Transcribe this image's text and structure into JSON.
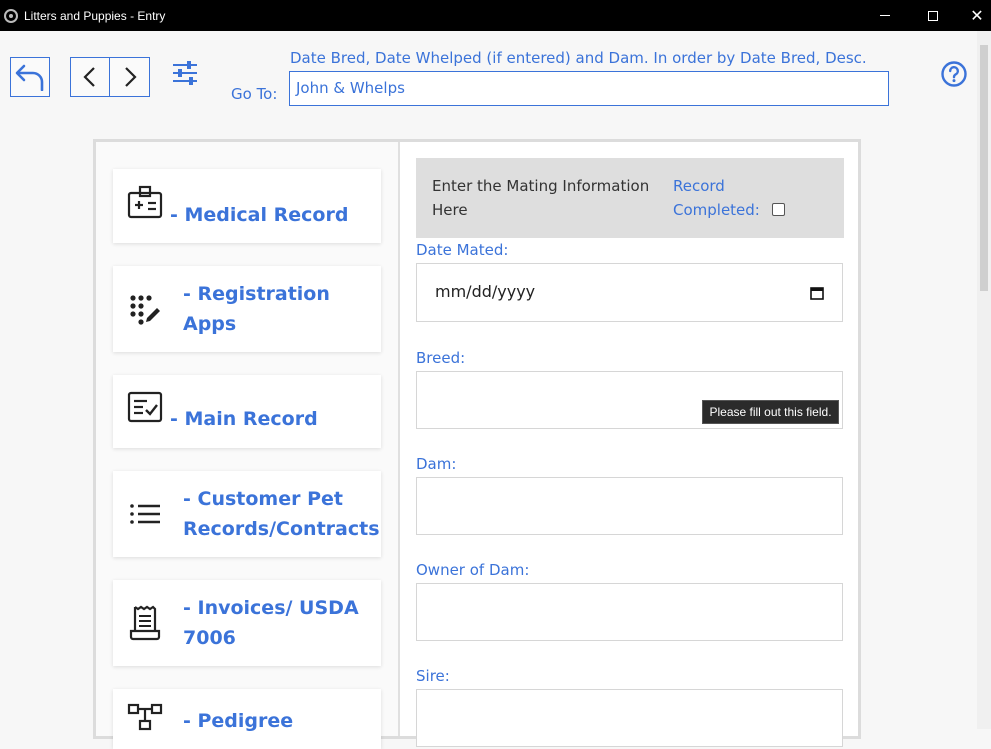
{
  "window": {
    "title": "Litters and Puppies - Entry",
    "close_glyph": "✕"
  },
  "toolbar": {
    "goto_label": "Go To:",
    "goto_hint": "Date Bred, Date Whelped (if entered) and Dam. In order by Date Bred, Desc.",
    "goto_value": "John & Whelps"
  },
  "nav_cards": [
    {
      "label": "- Medical Record",
      "icon": "medical-id-icon"
    },
    {
      "label_line1": "- Registration",
      "label_line2": "Apps",
      "icon": "dial-pen-icon"
    },
    {
      "label": "- Main Record",
      "icon": "checklist-icon"
    },
    {
      "label_line1": "- Customer Pet",
      "label_line2": "Records/Contracts",
      "icon": "list-icon"
    },
    {
      "label_line1": "- Invoices/ USDA",
      "label_line2": "7006",
      "icon": "receipt-icon"
    },
    {
      "label": "- Pedigree",
      "icon": "pedigree-tree-icon"
    }
  ],
  "form": {
    "header": "Enter the Mating Information Here",
    "record_completed": "Record Completed:",
    "date_mated_label": "Date Mated:",
    "date_mated_placeholder": "mm/dd/yyyy",
    "breed_label": "Breed:",
    "tooltip": "Please fill out this field.",
    "dam_label": "Dam:",
    "owner_label": "Owner of Dam:",
    "sire_label": "Sire:"
  },
  "colors": {
    "accent": "#3b73d9",
    "titlebar": "#000000",
    "header_bg": "#dedede"
  }
}
